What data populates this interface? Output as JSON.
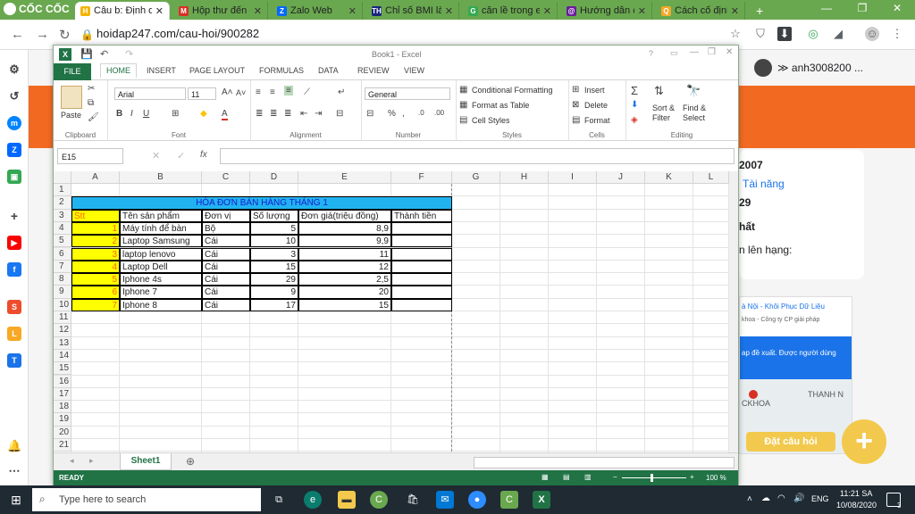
{
  "browser": {
    "brand": "CỐC CỐC",
    "tabs": [
      {
        "title": "Câu b: Định d",
        "favicon": "H",
        "color": "#f4b400",
        "active": true
      },
      {
        "title": "Hộp thư đến -",
        "favicon": "M",
        "color": "#d93025"
      },
      {
        "title": "Zalo Web",
        "favicon": "Z",
        "color": "#0068ff"
      },
      {
        "title": "Chỉ số BMI là g",
        "favicon": "TH",
        "color": "#1a237e"
      },
      {
        "title": "căn lề trong e",
        "favicon": "G",
        "color": "#34a853"
      },
      {
        "title": "Hướng dẫn cá",
        "favicon": "@",
        "color": "#6a1b9a"
      },
      {
        "title": "Cách cố định",
        "favicon": "Q",
        "color": "#f9a825"
      }
    ],
    "url": "hoidap247.com/cau-hoi/900282"
  },
  "website": {
    "username": "anh3008200 ...",
    "card_lines": [
      "2007",
      "Tài năng",
      "29",
      "hất",
      "n lên hạng:"
    ],
    "ad_lines": [
      "à Nội - Khôi Phục Dữ Liệu",
      "khoa - Công ty CP giải pháp",
      "ap đề xuất. Được người dùng",
      "THANH N",
      "CKHOA"
    ],
    "ask_button": "Đặt câu hỏi"
  },
  "excel": {
    "title": "Book1 - Excel",
    "menu": [
      "FILE",
      "HOME",
      "INSERT",
      "PAGE LAYOUT",
      "FORMULAS",
      "DATA",
      "REVIEW",
      "VIEW"
    ],
    "ribbon": {
      "paste": "Paste",
      "clipboard": "Clipboard",
      "font_name": "Arial",
      "font_size": "11",
      "font": "Font",
      "alignment": "Alignment",
      "number_format": "General",
      "number": "Number",
      "conditional": "Conditional Formatting",
      "format_table": "Format as Table",
      "cell_styles": "Cell Styles",
      "styles": "Styles",
      "insert": "Insert",
      "delete": "Delete",
      "format": "Format",
      "cells": "Cells",
      "sort": "Sort &",
      "filter": "Filter",
      "find": "Find &",
      "select": "Select",
      "editing": "Editing"
    },
    "name_box": "E15",
    "columns": [
      "A",
      "B",
      "C",
      "D",
      "E",
      "F",
      "G",
      "H",
      "I",
      "J",
      "K",
      "L"
    ],
    "rows": [
      "1",
      "2",
      "3",
      "4",
      "5",
      "6",
      "7",
      "8",
      "9",
      "10",
      "11",
      "12",
      "13",
      "14",
      "15",
      "16",
      "17",
      "18",
      "19",
      "20",
      "21"
    ],
    "table_title": "HÓA ĐƠN BÁN HÀNG THÁNG 1",
    "headers": [
      "Stt",
      "Tên sản phẩm",
      "Đơn vị",
      "Số lượng",
      "Đơn giá(triệu đồng)",
      "Thành tiền"
    ],
    "data_rows": [
      [
        "1",
        "Máy tính để bàn",
        "Bộ",
        "5",
        "8,9",
        ""
      ],
      [
        "2",
        "Laptop Samsung",
        "Cái",
        "10",
        "9,9",
        ""
      ],
      [
        "3",
        "laptop lenovo",
        "Cái",
        "3",
        "11",
        ""
      ],
      [
        "4",
        "Laptop Dell",
        "Cái",
        "15",
        "12",
        ""
      ],
      [
        "5",
        "Iphone 4s",
        "Cái",
        "29",
        "2,5",
        ""
      ],
      [
        "6",
        "Iphone 7",
        "Cái",
        "9",
        "20",
        ""
      ],
      [
        "7",
        "Iphone 8",
        "Cái",
        "17",
        "15",
        ""
      ]
    ],
    "sheet_tab": "Sheet1",
    "status": "READY",
    "zoom": "100 %"
  },
  "taskbar": {
    "search_placeholder": "Type here to search",
    "lang": "ENG",
    "time": "11:21 SA",
    "date": "10/08/2020",
    "notif_count": "3"
  }
}
